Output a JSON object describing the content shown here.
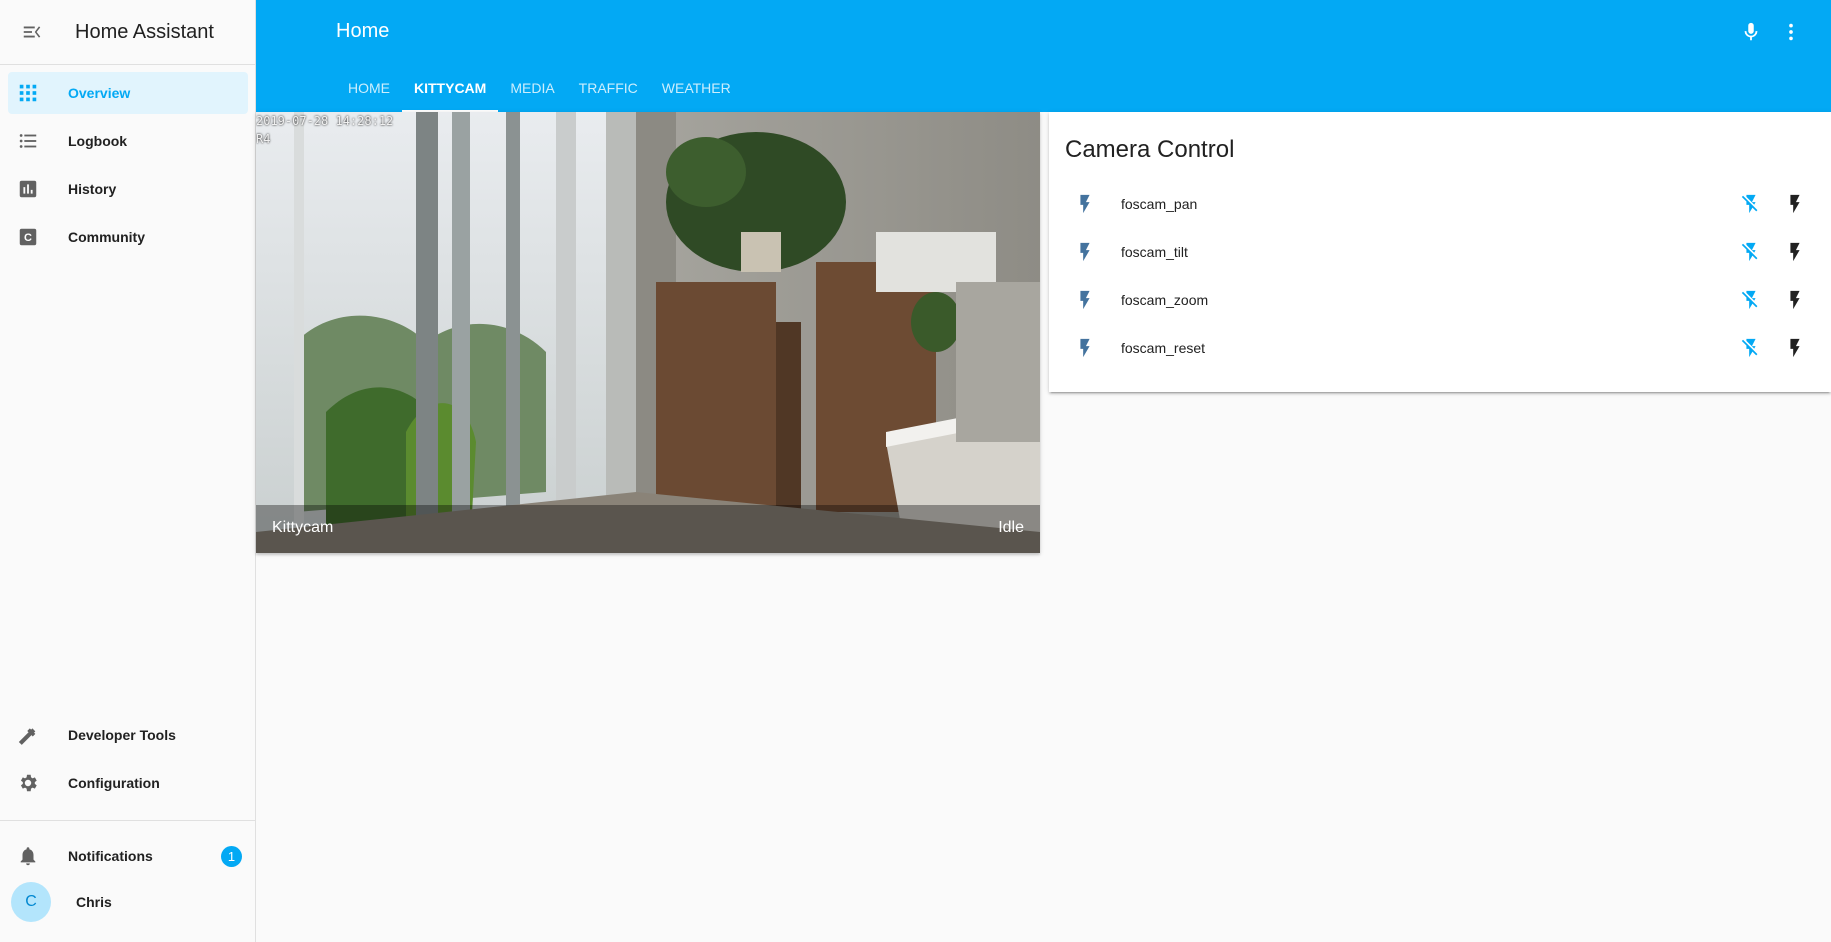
{
  "app": {
    "title": "Home Assistant"
  },
  "sidebar": {
    "items": [
      {
        "label": "Overview",
        "icon": "view-dashboard-icon",
        "active": true
      },
      {
        "label": "Logbook",
        "icon": "format-list-bulleted-icon"
      },
      {
        "label": "History",
        "icon": "chart-box-icon"
      },
      {
        "label": "Community",
        "icon": "community-c-icon"
      }
    ],
    "bottom_items": [
      {
        "label": "Developer Tools",
        "icon": "hammer-icon"
      },
      {
        "label": "Configuration",
        "icon": "gear-icon"
      }
    ],
    "notifications": {
      "label": "Notifications",
      "count": "1",
      "icon": "bell-icon"
    },
    "user": {
      "name": "Chris",
      "initial": "C"
    }
  },
  "header": {
    "title": "Home",
    "tabs": [
      "HOME",
      "KITTYCAM",
      "MEDIA",
      "TRAFFIC",
      "WEATHER"
    ],
    "active_tab": "KITTYCAM"
  },
  "camera": {
    "timestamp": "2019-07-28 14:28:12",
    "channel": "R4",
    "name": "Kittycam",
    "state": "Idle"
  },
  "camera_control": {
    "title": "Camera Control",
    "entities": [
      {
        "name": "foscam_pan"
      },
      {
        "name": "foscam_tilt"
      },
      {
        "name": "foscam_zoom"
      },
      {
        "name": "foscam_reset"
      }
    ]
  },
  "colors": {
    "primary": "#03a9f4",
    "state_icon": "#44739e",
    "off_button": "#03a9f4",
    "on_button": "#212121"
  }
}
